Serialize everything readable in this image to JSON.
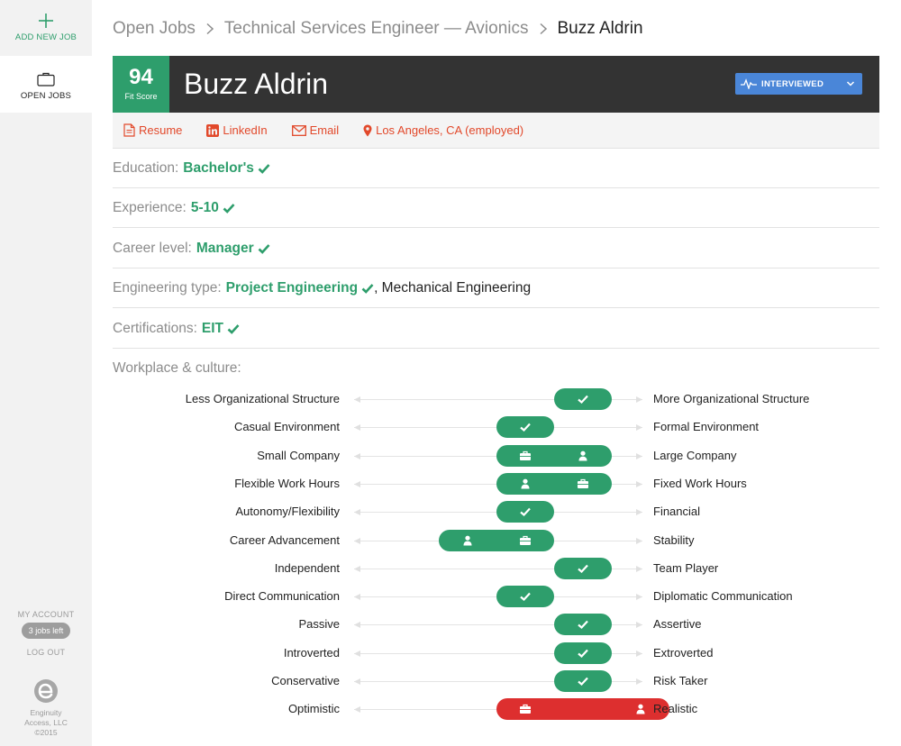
{
  "sidebar": {
    "add_job_label": "ADD NEW JOB",
    "open_jobs_label": "OPEN JOBS",
    "my_account_label": "MY ACCOUNT",
    "jobs_left_badge": "3 jobs left",
    "logout_label": "LOG OUT",
    "copyright_lines": [
      "Enginuity",
      "Access, LLC",
      "©2015"
    ]
  },
  "breadcrumb": {
    "items": [
      "Open Jobs",
      "Technical Services Engineer — Avionics",
      "Buzz Aldrin"
    ]
  },
  "candidate": {
    "fit_score": "94",
    "fit_score_label": "Fit Score",
    "name": "Buzz Aldrin",
    "status": "INTERVIEWED"
  },
  "links": {
    "resume": "Resume",
    "linkedin": "LinkedIn",
    "email": "Email",
    "location": "Los Angeles, CA (employed)"
  },
  "attributes": [
    {
      "label": "Education:",
      "value": "Bachelor's",
      "other": ""
    },
    {
      "label": "Experience:",
      "value": "5-10",
      "other": ""
    },
    {
      "label": "Career level:",
      "value": "Manager",
      "other": ""
    },
    {
      "label": "Engineering type:",
      "value": "Project Engineering",
      "other": ", Mechanical Engineering"
    },
    {
      "label": "Certifications:",
      "value": "EIT",
      "other": ""
    }
  ],
  "culture": {
    "title": "Workplace & culture:",
    "positions": 5,
    "rows": [
      {
        "left": "Less Organizational Structure",
        "right": "More Organizational Structure",
        "job": 4,
        "candidate": 4,
        "match": true
      },
      {
        "left": "Casual Environment",
        "right": "Formal Environment",
        "job": 3,
        "candidate": 3,
        "match": true
      },
      {
        "left": "Small Company",
        "right": "Large Company",
        "job": 3,
        "candidate": 4,
        "match": true
      },
      {
        "left": "Flexible Work Hours",
        "right": "Fixed Work Hours",
        "job": 4,
        "candidate": 3,
        "match": true
      },
      {
        "left": "Autonomy/Flexibility",
        "right": "Financial",
        "job": 3,
        "candidate": 3,
        "match": true
      },
      {
        "left": "Career Advancement",
        "right": "Stability",
        "job": 3,
        "candidate": 2,
        "match": true
      },
      {
        "left": "Independent",
        "right": "Team Player",
        "job": 4,
        "candidate": 4,
        "match": true
      },
      {
        "left": "Direct Communication",
        "right": "Diplomatic Communication",
        "job": 3,
        "candidate": 3,
        "match": true
      },
      {
        "left": "Passive",
        "right": "Assertive",
        "job": 4,
        "candidate": 4,
        "match": true
      },
      {
        "left": "Introverted",
        "right": "Extroverted",
        "job": 4,
        "candidate": 4,
        "match": true
      },
      {
        "left": "Conservative",
        "right": "Risk Taker",
        "job": 4,
        "candidate": 4,
        "match": true
      },
      {
        "left": "Optimistic",
        "right": "Realistic",
        "job": 3,
        "candidate": 5,
        "match": false
      }
    ]
  },
  "colors": {
    "green": "#2e9e6c",
    "red": "#dd2f2f",
    "link_red": "#e2492b",
    "status_blue": "#4a86d8",
    "header_dark": "#333333"
  }
}
